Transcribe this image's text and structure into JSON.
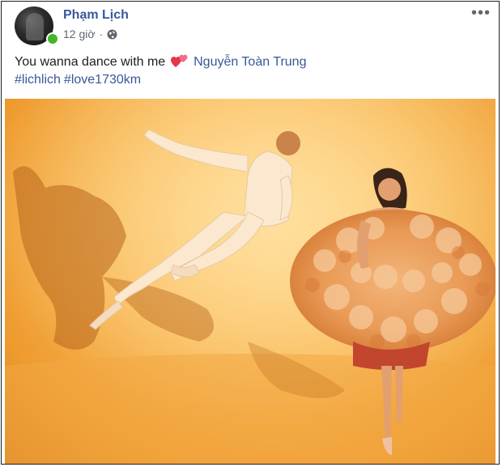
{
  "post": {
    "author": "Phạm Lịch",
    "timestamp": "12 giờ",
    "separator": "·",
    "privacy_icon": "globe-icon",
    "more_icon": "more-options-icon",
    "online_status": "online",
    "caption_text": "You wanna dance with me",
    "caption_emoji": "two-hearts-icon",
    "mention": "Nguyễn Toàn Trung",
    "hashtags": [
      "#lichlich",
      "#love1730km"
    ]
  },
  "photo": {
    "subject": "dancer-leaping-and-ballerina-in-flower-dress"
  },
  "colors": {
    "link": "#385898",
    "text": "#1c1e21",
    "meta": "#606770",
    "online": "#42b72a",
    "photo_bg": "#f9bb5a"
  }
}
